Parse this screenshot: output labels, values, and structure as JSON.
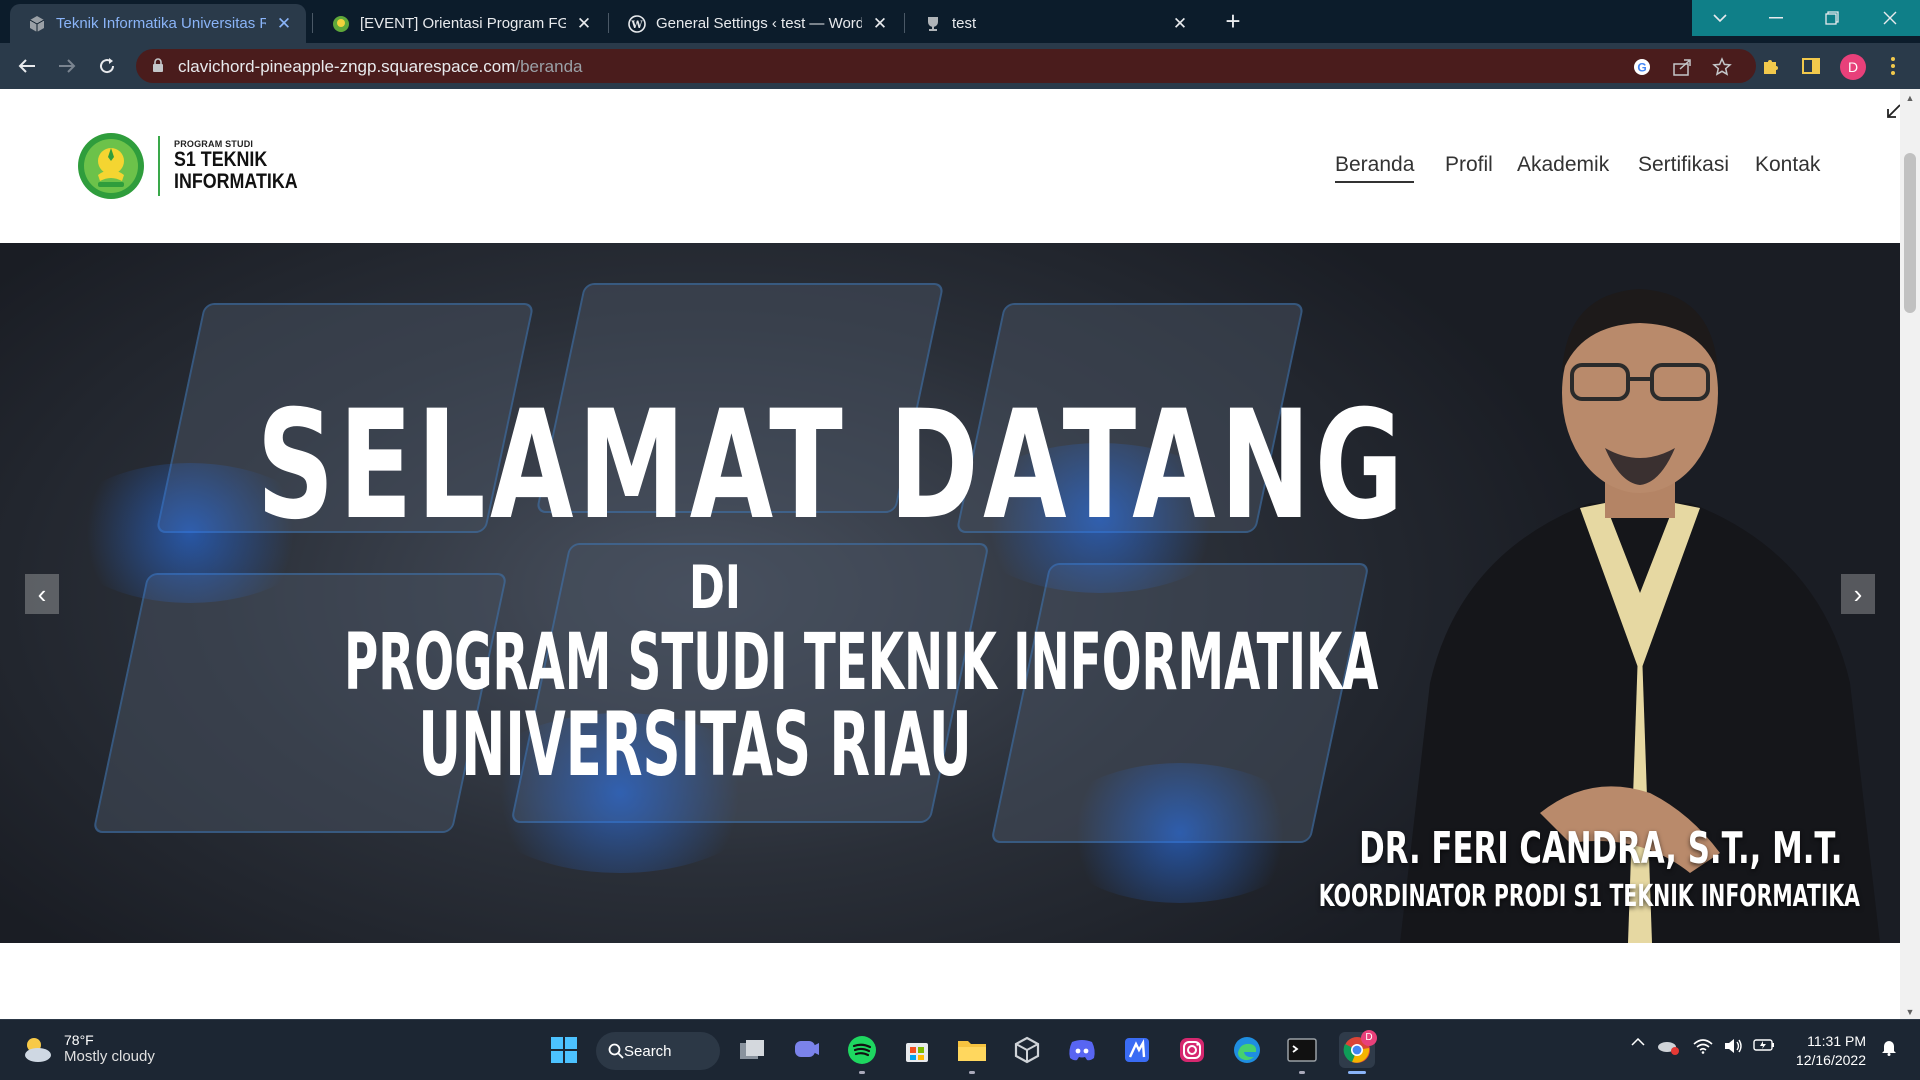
{
  "browser": {
    "tabs": [
      {
        "title": "Teknik Informatika Universitas Riau",
        "active": true,
        "favicon": "squarespace-cube-icon"
      },
      {
        "title": "[EVENT] Orientasi Program FGA D",
        "active": false,
        "favicon": "unri-logo-icon"
      },
      {
        "title": "General Settings ‹ test — WordPress",
        "active": false,
        "favicon": "wordpress-icon"
      },
      {
        "title": "test",
        "active": false,
        "favicon": "trophy-icon"
      }
    ],
    "url_host": "clavichord-pineapple-zngp.squarespace.com",
    "url_path": "/beranda",
    "profile_initial": "D"
  },
  "site": {
    "logo": {
      "small": "PROGRAM STUDI",
      "line1": "S1 TEKNIK",
      "line2": "INFORMATIKA"
    },
    "nav": [
      "Beranda",
      "Profil",
      "Akademik",
      "Sertifikasi",
      "Kontak"
    ],
    "current_nav": "Beranda"
  },
  "hero": {
    "headline": "SELAMAT DATANG",
    "di": "DI",
    "program": "PROGRAM STUDI TEKNIK INFORMATIKA",
    "university": "UNIVERSITAS RIAU",
    "person_name": "DR. FERI CANDRA, S.T., M.T.",
    "person_role": "KOORDINATOR PRODI S1 TEKNIK INFORMATIKA",
    "prev": "‹",
    "next": "›"
  },
  "taskbar": {
    "weather_temp": "78°F",
    "weather_desc": "Mostly cloudy",
    "search_label": "Search",
    "time": "11:31 PM",
    "date": "12/16/2022",
    "chrome_badge": "D"
  },
  "colors": {
    "accent": "#8ab4f8",
    "logo_green": "#3aa84a",
    "omnibox": "#4a1c1c"
  }
}
